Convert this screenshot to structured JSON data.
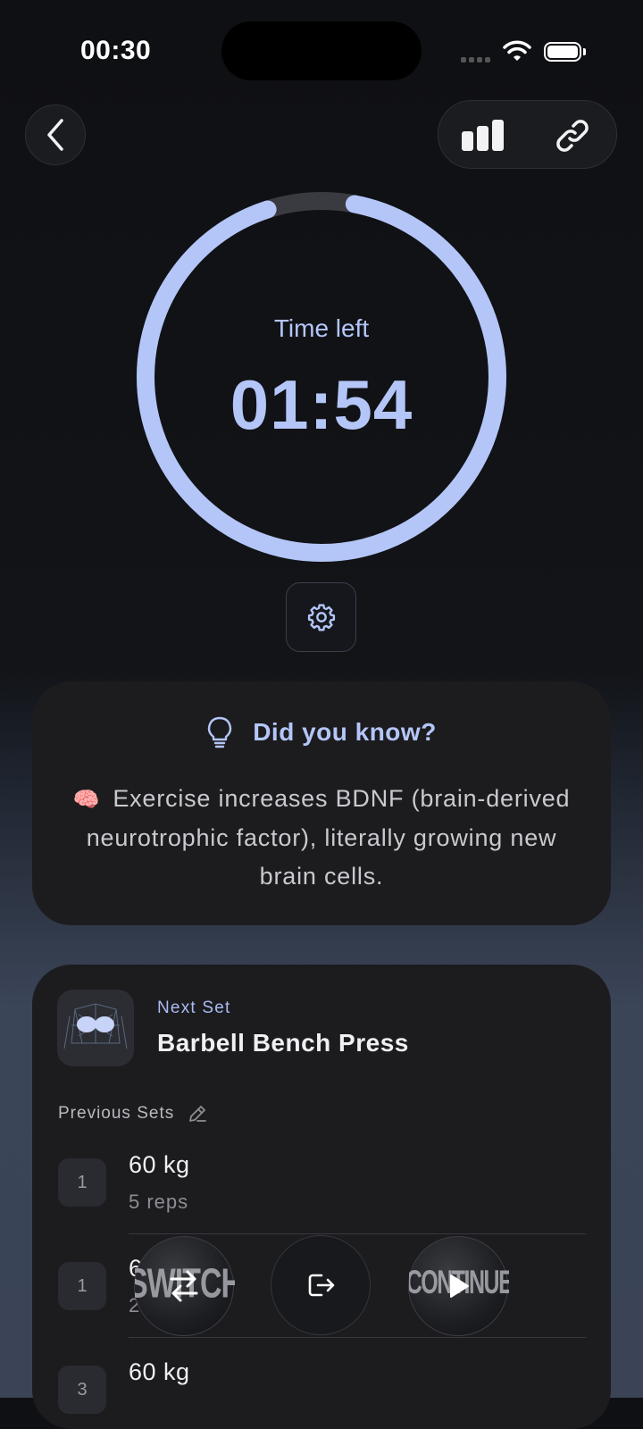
{
  "status_bar": {
    "time": "00:30"
  },
  "header": {
    "back_icon": "chevron-left-icon",
    "stats_icon": "bar-chart-icon",
    "link_icon": "link-icon"
  },
  "timer": {
    "label": "Time left",
    "value": "01:54",
    "progress_fraction": 0.95,
    "ring_color": "#b4c6f8",
    "track_color": "#3a3b40",
    "settings_icon": "gear-icon"
  },
  "did_you_know": {
    "icon": "lightbulb-icon",
    "title": "Did you know?",
    "emoji": "🧠",
    "text": "Exercise increases BDNF (brain-derived neurotrophic factor), literally growing new brain cells."
  },
  "next_set": {
    "label": "Next Set",
    "exercise": "Barbell Bench Press",
    "previous_label": "Previous Sets",
    "sets": [
      {
        "num": "1",
        "weight": "60 kg",
        "reps": "5 reps"
      },
      {
        "num": "1",
        "weight": "6",
        "reps": "2"
      },
      {
        "num": "3",
        "weight": "60 kg",
        "reps": ""
      }
    ]
  },
  "actions": {
    "switch_label": "SWITCH",
    "continue_label": "CONTINUE",
    "switch_icon": "swap-arrows-icon",
    "exit_icon": "exit-icon",
    "play_icon": "play-icon"
  },
  "accent_color": "#b4c6f8"
}
